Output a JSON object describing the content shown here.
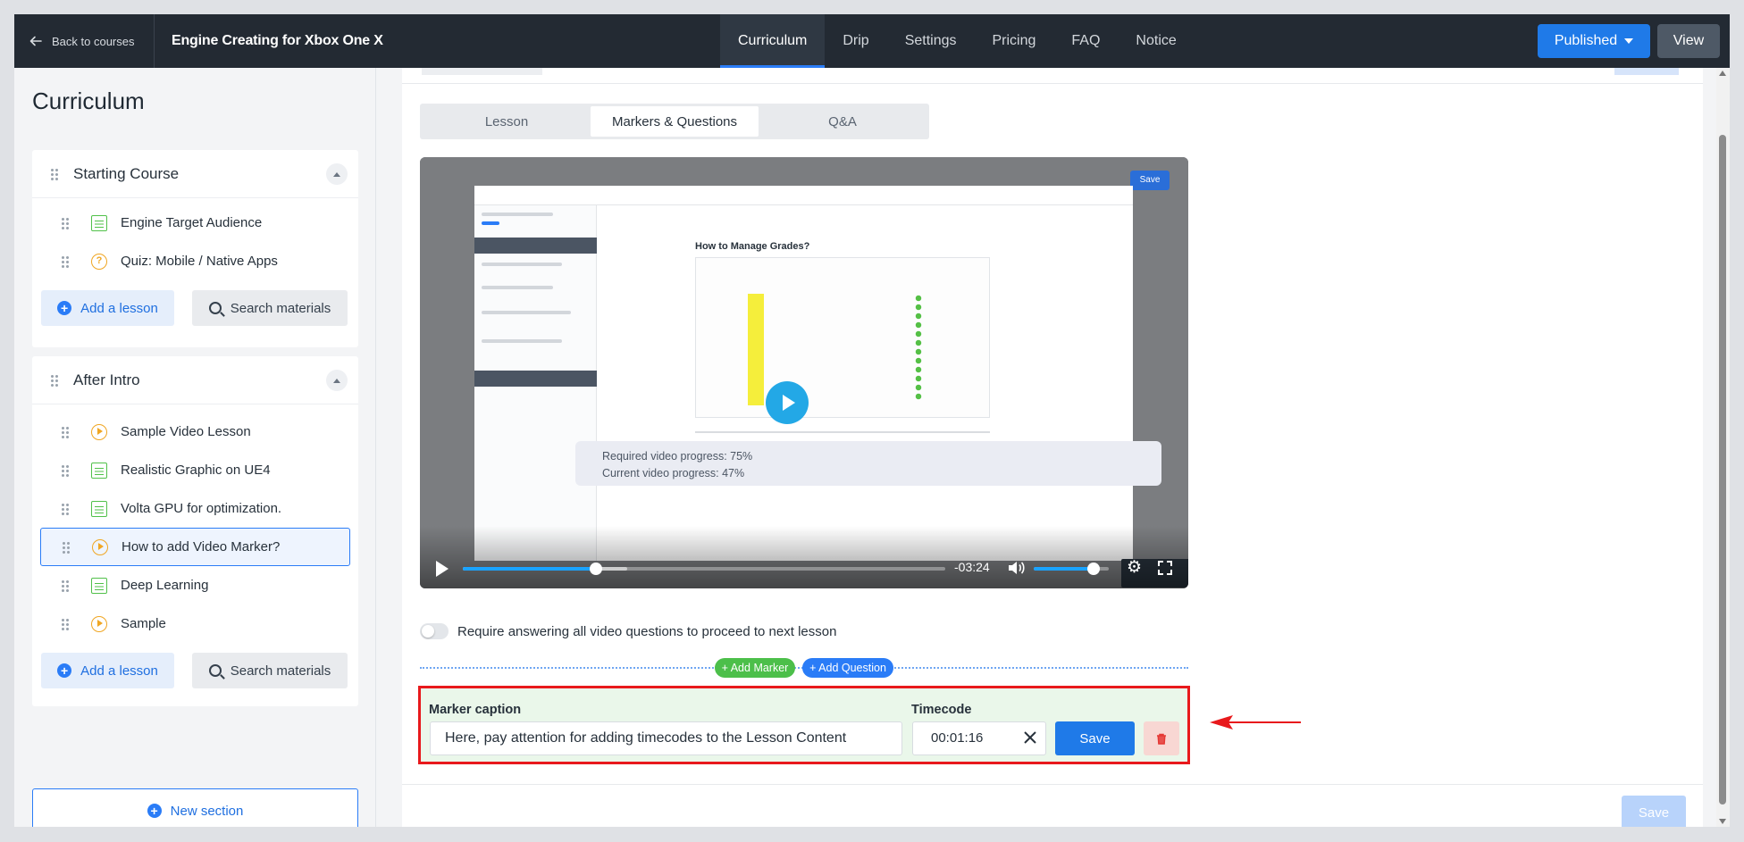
{
  "header": {
    "back_label": "Back to courses",
    "course_title": "Engine Creating for Xbox One X",
    "tabs": [
      "Curriculum",
      "Drip",
      "Settings",
      "Pricing",
      "FAQ",
      "Notice"
    ],
    "active_tab": "Curriculum",
    "publish_label": "Published",
    "view_label": "View"
  },
  "sidebar": {
    "title": "Curriculum",
    "sections": [
      {
        "title": "Starting Course",
        "lessons": [
          {
            "label": "Engine Target Audience",
            "icon": "document-icon"
          },
          {
            "label": "Quiz: Mobile / Native Apps",
            "icon": "quiz-icon"
          }
        ]
      },
      {
        "title": "After Intro",
        "lessons": [
          {
            "label": "Sample Video Lesson",
            "icon": "video-icon"
          },
          {
            "label": "Realistic Graphic on UE4",
            "icon": "document-icon"
          },
          {
            "label": "Volta GPU for optimization.",
            "icon": "document-icon"
          },
          {
            "label": "How to add Video Marker?",
            "icon": "video-icon",
            "selected": true
          },
          {
            "label": "Deep Learning",
            "icon": "document-icon"
          },
          {
            "label": "Sample",
            "icon": "video-icon"
          }
        ]
      }
    ],
    "add_lesson_label": "Add a lesson",
    "search_materials_label": "Search materials",
    "new_section_label": "New section"
  },
  "main": {
    "sub_tabs": [
      "Lesson",
      "Markers & Questions",
      "Q&A"
    ],
    "active_sub_tab": "Markers & Questions",
    "video": {
      "embedded": {
        "save": "Save",
        "heading": "How to Manage Grades?",
        "required_progress": "Required video progress: 75%",
        "current_progress": "Current video progress: 47%"
      },
      "progress_fraction": 0.275,
      "buffered_fraction": 0.34,
      "volume_fraction": 0.8,
      "time_remaining": "-03:24"
    },
    "require_answer_label": "Require answering all video questions to proceed to next lesson",
    "add_marker_label": "+ Add Marker",
    "add_question_label": "+ Add Question",
    "marker": {
      "caption_label": "Marker caption",
      "caption_value": "Here, pay attention for adding timecodes to the Lesson Content",
      "timecode_label": "Timecode",
      "timecode_value": "00:01:16",
      "save_label": "Save"
    },
    "save_label": "Save"
  },
  "colors": {
    "accent": "#1f7ae8",
    "topbar": "#232a33",
    "highlight_border": "#e8191c",
    "marker_green": "#4cbf4a"
  }
}
